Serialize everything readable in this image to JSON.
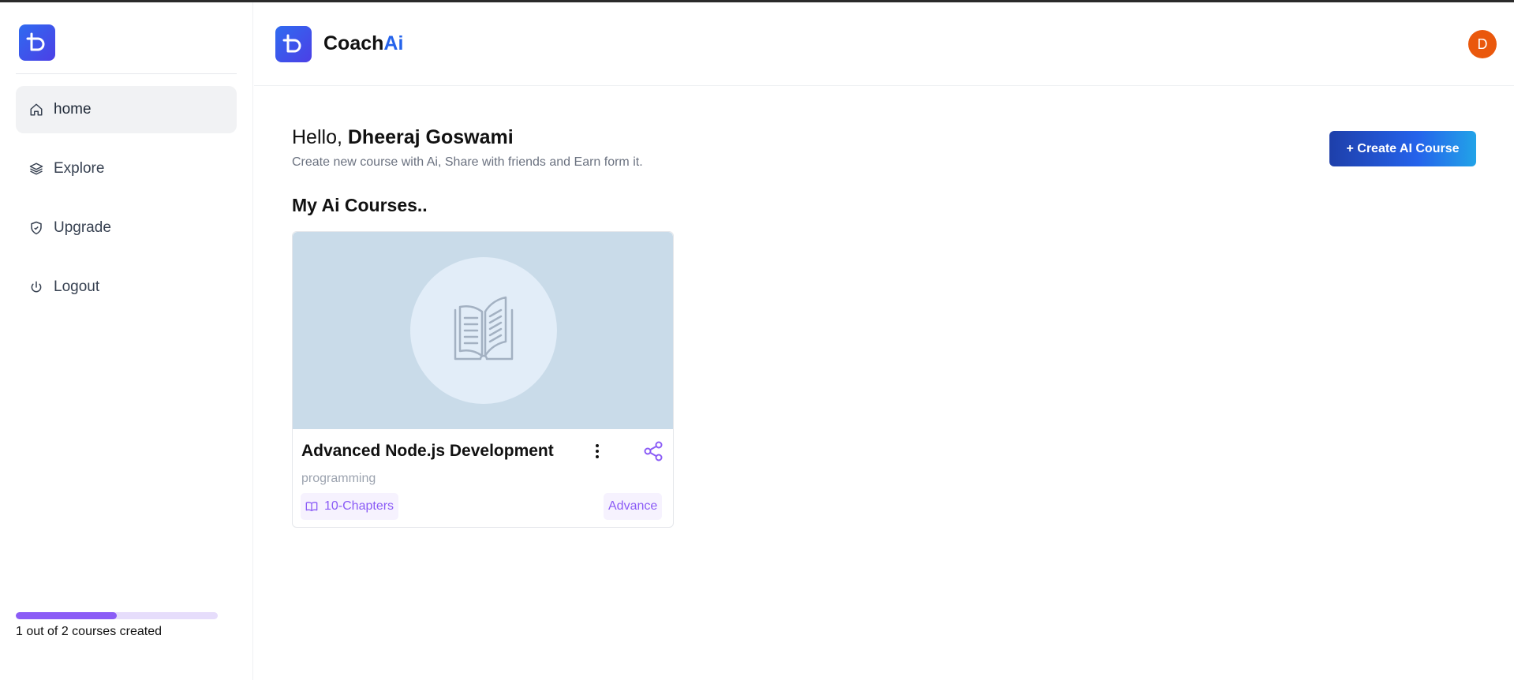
{
  "app": {
    "brand_main": "Coach",
    "brand_accent": "Ai",
    "avatar_initial": "D"
  },
  "sidebar": {
    "items": [
      {
        "label": "home",
        "icon": "home-icon",
        "active": true
      },
      {
        "label": "Explore",
        "icon": "layers-icon",
        "active": false
      },
      {
        "label": "Upgrade",
        "icon": "shield-icon",
        "active": false
      },
      {
        "label": "Logout",
        "icon": "power-icon",
        "active": false
      }
    ],
    "progress": {
      "text": "1 out of 2 courses created",
      "fraction": 0.5
    }
  },
  "main": {
    "greeting_prefix": "Hello, ",
    "user_name": "Dheeraj Goswami",
    "subtitle": "Create new course with Ai, Share with friends and Earn form it.",
    "create_button": "+ Create AI Course",
    "section_title": "My Ai Courses.."
  },
  "courses": [
    {
      "title": "Advanced Node.js Development",
      "category": "programming",
      "chapters": "10-Chapters",
      "level": "Advance"
    }
  ],
  "colors": {
    "accent_purple": "#8b5cf6",
    "brand_blue": "#2563eb",
    "avatar_orange": "#ea580c"
  }
}
